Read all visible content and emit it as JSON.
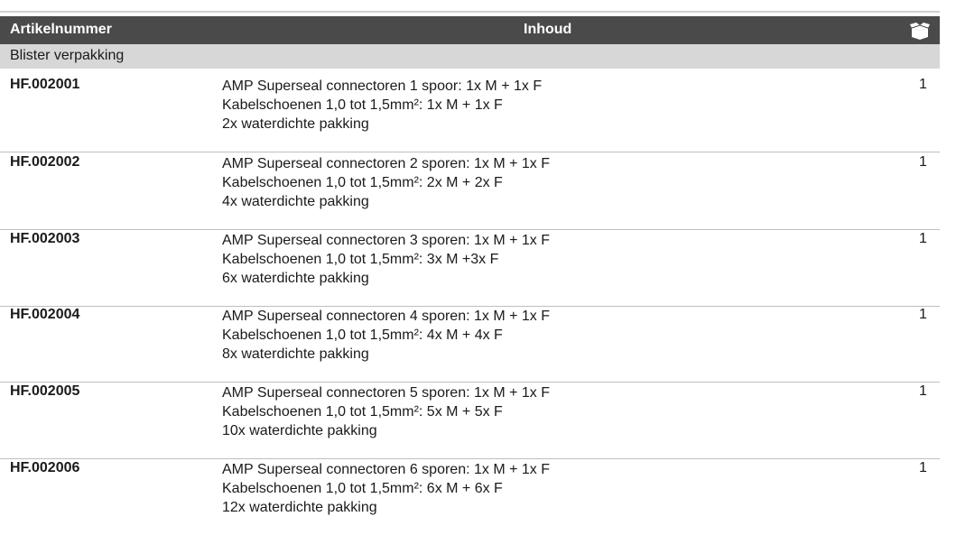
{
  "header": {
    "col_article": "Artikelnummer",
    "col_content": "Inhoud",
    "col_qty_icon": "box-icon"
  },
  "section": "Blister verpakking",
  "rows": [
    {
      "code": "HF.002001",
      "lines": [
        "AMP Superseal connectoren 1 spoor: 1x M + 1x F",
        "Kabelschoenen 1,0 tot 1,5mm²: 1x M + 1x F",
        "2x waterdichte pakking"
      ],
      "qty": "1"
    },
    {
      "code": "HF.002002",
      "lines": [
        "AMP Superseal connectoren 2 sporen: 1x M + 1x F",
        "Kabelschoenen 1,0 tot 1,5mm²: 2x M + 2x F",
        "4x waterdichte pakking"
      ],
      "qty": "1"
    },
    {
      "code": "HF.002003",
      "lines": [
        "AMP Superseal connectoren 3 sporen: 1x M + 1x F",
        "Kabelschoenen 1,0 tot 1,5mm²: 3x M +3x F",
        "6x waterdichte pakking"
      ],
      "qty": "1"
    },
    {
      "code": "HF.002004",
      "lines": [
        "AMP Superseal connectoren 4 sporen: 1x M + 1x F",
        "Kabelschoenen 1,0 tot 1,5mm²: 4x M + 4x F",
        "8x waterdichte pakking"
      ],
      "qty": "1"
    },
    {
      "code": "HF.002005",
      "lines": [
        "AMP Superseal connectoren 5 sporen: 1x M + 1x F",
        "Kabelschoenen 1,0 tot 1,5mm²: 5x M + 5x F",
        "10x waterdichte pakking"
      ],
      "qty": "1"
    },
    {
      "code": "HF.002006",
      "lines": [
        "AMP Superseal connectoren 6 sporen: 1x M + 1x F",
        "Kabelschoenen 1,0 tot 1,5mm²: 6x M + 6x F",
        "12x waterdichte pakking"
      ],
      "qty": "1"
    }
  ]
}
